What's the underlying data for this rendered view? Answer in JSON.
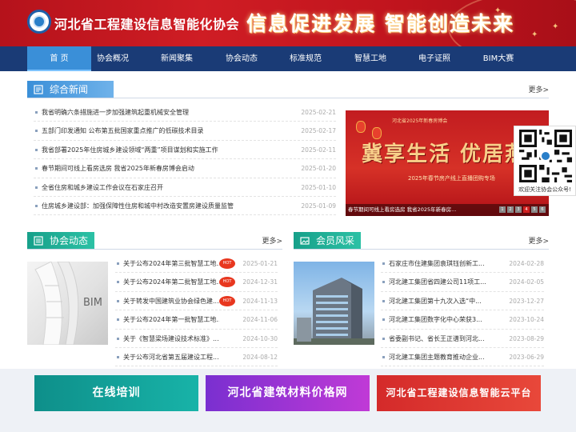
{
  "header": {
    "site_title": "河北省工程建设信息智能化协会",
    "slogan": "信息促进发展  智能创造未来"
  },
  "nav": {
    "items": [
      {
        "label": "首  页",
        "active": true
      },
      {
        "label": "协会概况"
      },
      {
        "label": "新闻聚集"
      },
      {
        "label": "协会动态"
      },
      {
        "label": "标准规范"
      },
      {
        "label": "智慧工地"
      },
      {
        "label": "电子证照"
      },
      {
        "label": "BIM大赛"
      }
    ]
  },
  "comprehensive_news": {
    "title": "综合新闻",
    "more": "更多>",
    "items": [
      {
        "title": "我省明确六条措施进一步加强建筑起重机械安全管理",
        "date": "2025-02-21"
      },
      {
        "title": "五部门印发通知 公布第五批国家重点推广的低碳技术目录",
        "date": "2025-02-17"
      },
      {
        "title": "我省部署2025年住房城乡建设领域“两重”项目谋划和实施工作",
        "date": "2025-02-11"
      },
      {
        "title": "春节期间可线上看房选房 我省2025年新春房博会启动",
        "date": "2025-01-20"
      },
      {
        "title": "全省住房和城乡建设工作会议在石家庄召开",
        "date": "2025-01-10"
      },
      {
        "title": "住房城乡建设部：加强保障性住房和城中村改造安置房建设质量监管",
        "date": "2025-01-09"
      }
    ]
  },
  "banner": {
    "top_text": "河北省2025年新春房博会",
    "headline": "冀享生活  优居燕赵",
    "sub_text": "2025年春节房产线上直播团购专场",
    "caption": "春节期间可线上看房选房 我省2025年新春房...",
    "pages": [
      "1",
      "2",
      "3",
      "4",
      "5",
      "6"
    ],
    "active_page": 4
  },
  "qr": {
    "label": "欢迎关注协会公众号!"
  },
  "association_news": {
    "title": "协会动态",
    "more": "更多>",
    "thumb_text": "BIM",
    "items": [
      {
        "title": "关于公布2024年第三批智慧工地...",
        "date": "2025-01-21",
        "hot": true
      },
      {
        "title": "关于公布2024年第二批智慧工地...",
        "date": "2024-12-31",
        "hot": true
      },
      {
        "title": "关于转发中国建筑业协会绿色建...",
        "date": "2024-11-13",
        "hot": true
      },
      {
        "title": "关于公布2024年第一批智慧工地...",
        "date": "2024-11-06",
        "hot": false
      },
      {
        "title": "关于《智慧梁场建设技术标准》...",
        "date": "2024-10-30",
        "hot": false
      },
      {
        "title": "关于公布河北省第五届建设工程...",
        "date": "2024-08-12",
        "hot": false
      }
    ],
    "hot_label": "HOT"
  },
  "member_style": {
    "title": "会员风采",
    "more": "更多>",
    "items": [
      {
        "title": "石家庄市住建集团袁琪钰创新工...",
        "date": "2024-02-28"
      },
      {
        "title": "河北建工集团省四建公司11项工...",
        "date": "2024-02-05"
      },
      {
        "title": "河北建工集团第十九次入选“中...",
        "date": "2023-12-27"
      },
      {
        "title": "河北建工集团数字化中心荣获3...",
        "date": "2023-10-24"
      },
      {
        "title": "省委副书记、省长王正谱到河北...",
        "date": "2023-08-29"
      },
      {
        "title": "河北建工集团主题教育推动企业...",
        "date": "2023-06-29"
      }
    ]
  },
  "bottom_links": [
    {
      "label": "在线培训"
    },
    {
      "label": "河北省建筑材料价格网"
    },
    {
      "label": "河北省工程建设信息智能云平台"
    }
  ],
  "colors": {
    "header_red": "#c0141d",
    "nav_blue": "#1a3b76",
    "nav_active": "#3a8fd8",
    "section_blue": "#3a8fd8",
    "section_green": "#17a08a",
    "hot_red": "#e8371f"
  }
}
